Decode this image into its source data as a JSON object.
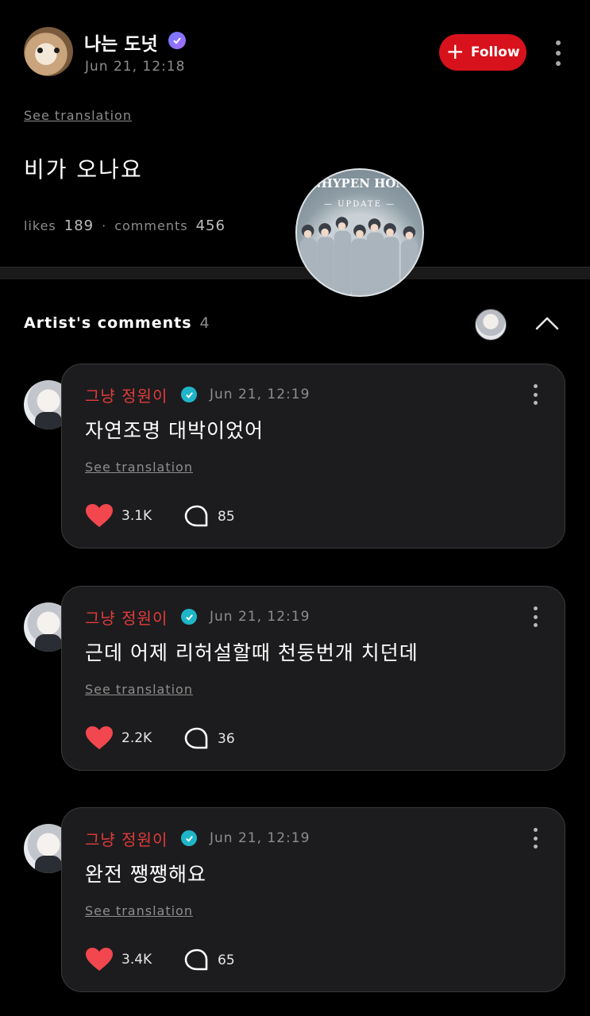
{
  "post": {
    "author": "나는 도넛",
    "time": "Jun 21, 12:18",
    "follow_label": "Follow",
    "see_translation": "See translation",
    "body": "비가 오나요",
    "likes_label": "likes",
    "likes": "189",
    "separator": "·",
    "comments_label": "comments",
    "comments": "456"
  },
  "watermark": {
    "title": "ENHYPEN HOME",
    "subtitle": "— UPDATE —"
  },
  "artist_comments": {
    "title": "Artist's comments",
    "count": "4"
  },
  "comments": [
    {
      "name": "그냥 정원이",
      "time": "Jun 21, 12:19",
      "text": "자연조명 대박이었어",
      "see_translation": "See translation",
      "likes": "3.1K",
      "replies": "85"
    },
    {
      "name": "그냥 정원이",
      "time": "Jun 21, 12:19",
      "text": "근데 어제 리허설할때 천둥번개 치던데",
      "see_translation": "See translation",
      "likes": "2.2K",
      "replies": "36"
    },
    {
      "name": "그냥 정원이",
      "time": "Jun 21, 12:19",
      "text": "완전 쨍쨍해요",
      "see_translation": "See translation",
      "likes": "3.4K",
      "replies": "65"
    }
  ],
  "colors": {
    "accent_red": "#d8121c",
    "heart": "#f2474f",
    "artist_name": "#e23b3b",
    "verified_artist": "#1fb5c9",
    "verified_user": "#7d6bff"
  }
}
